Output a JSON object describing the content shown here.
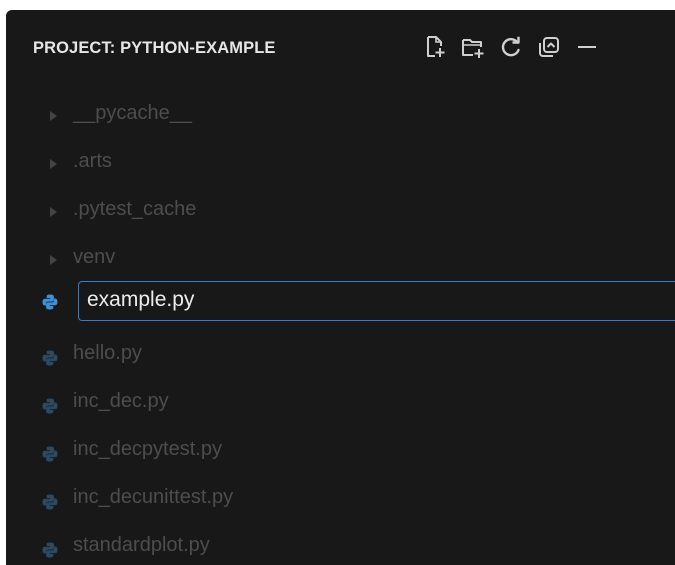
{
  "explorer": {
    "title": "PROJECT: PYTHON-EXAMPLE",
    "actions": [
      {
        "name": "new-file-icon"
      },
      {
        "name": "new-folder-icon"
      },
      {
        "name": "refresh-icon"
      },
      {
        "name": "collapse-all-icon"
      },
      {
        "name": "minimize-icon"
      }
    ]
  },
  "tree": {
    "folders": [
      {
        "label": "__pycache__"
      },
      {
        "label": ".arts"
      },
      {
        "label": ".pytest_cache"
      },
      {
        "label": "venv"
      }
    ],
    "rename_input": {
      "value": "example.py"
    },
    "files": [
      {
        "label": "hello.py"
      },
      {
        "label": "inc_dec.py"
      },
      {
        "label": "inc_decpytest.py"
      },
      {
        "label": "inc_decunittest.py"
      },
      {
        "label": "standardplot.py"
      }
    ]
  },
  "colors": {
    "panel_bg": "#181818",
    "title": "#e6e6e6",
    "dim_text": "#4d4d4d",
    "focus_border": "#2f7fd6",
    "python_icon_active": "#3d8fd6",
    "python_icon_dim": "#2b4a63"
  }
}
